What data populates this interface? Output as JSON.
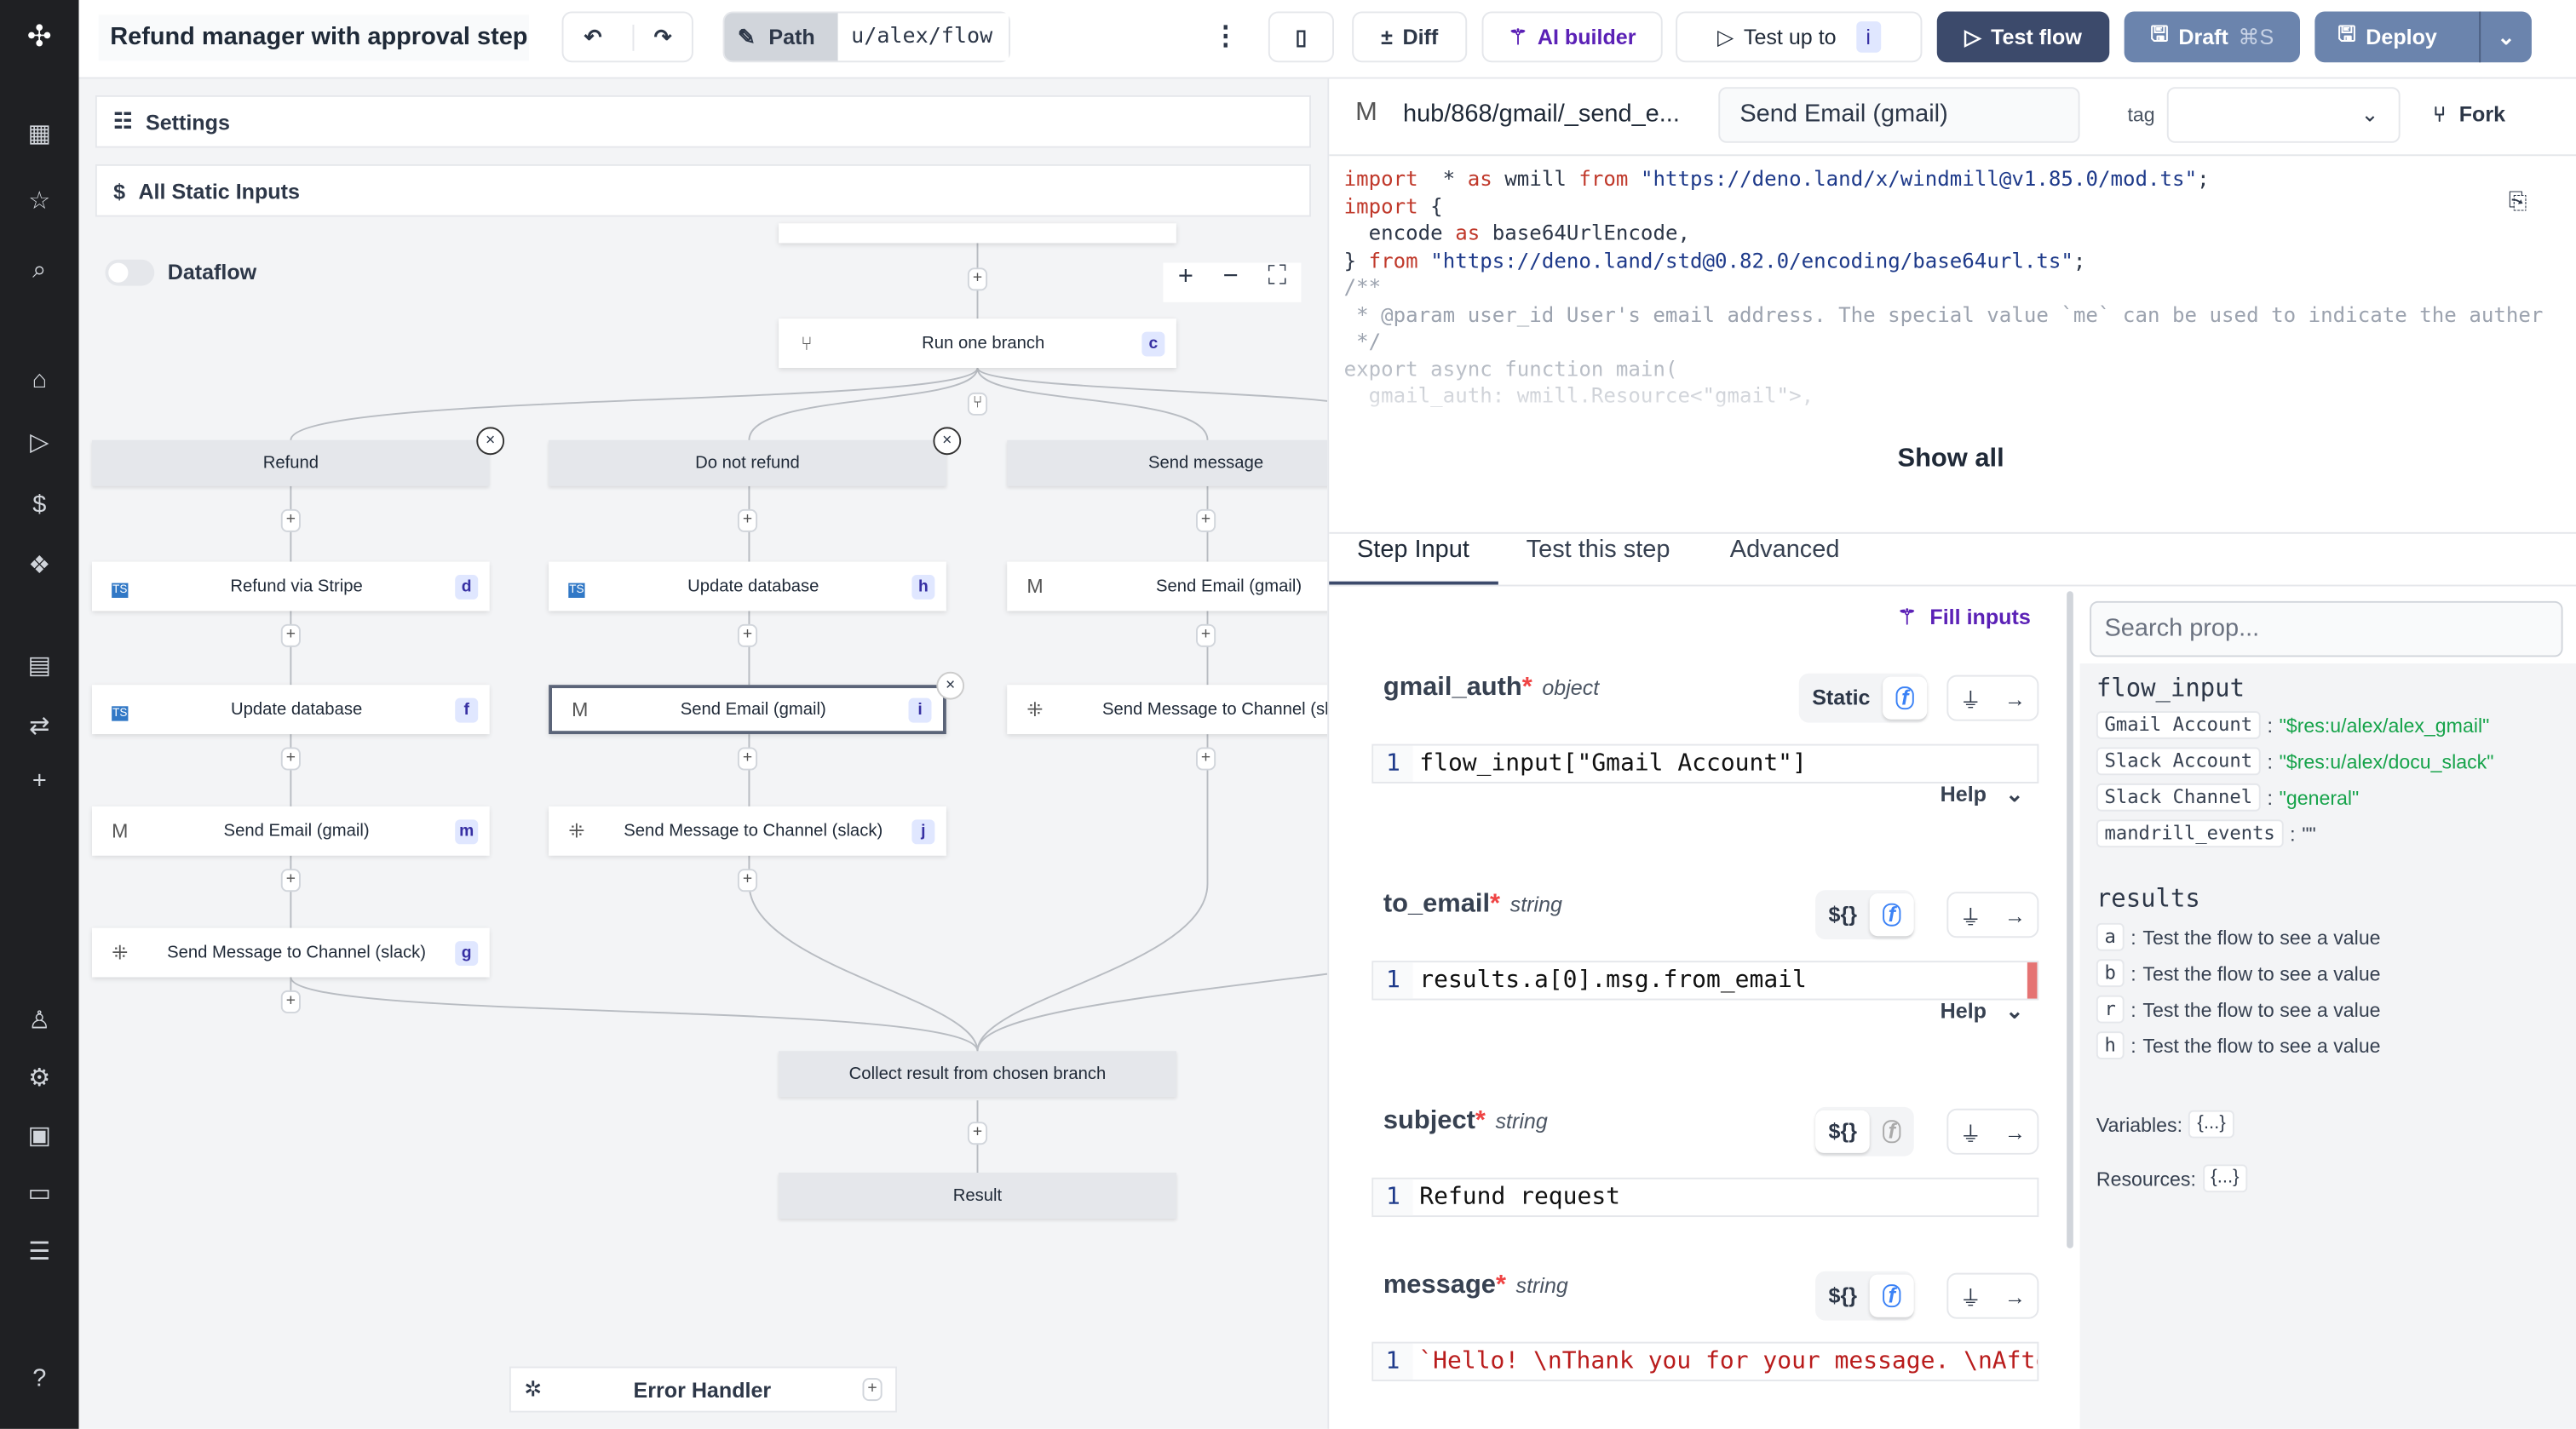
{
  "app": {
    "title": "Refund manager with approval step",
    "path_label": "Path",
    "path_value": "u/alex/flow"
  },
  "toolbar": {
    "diff": "Diff",
    "ai_builder": "AI builder",
    "test_up_to": "Test up to",
    "test_up_to_id": "i",
    "test_flow": "Test flow",
    "draft": "Draft",
    "draft_shortcut": "⌘S",
    "deploy": "Deploy"
  },
  "canvas": {
    "settings": "Settings",
    "static_inputs": "All Static Inputs",
    "dataflow": "Dataflow",
    "dataflow_on": false,
    "run_one_branch": {
      "label": "Run one branch",
      "id": "c"
    },
    "branches": [
      {
        "label": "Refund",
        "nodes": [
          {
            "label": "Refund via Stripe",
            "id": "d",
            "icon": "typescript-icon"
          },
          {
            "label": "Update database",
            "id": "f",
            "icon": "typescript-icon"
          },
          {
            "label": "Send Email (gmail)",
            "id": "m",
            "icon": "gmail-icon"
          },
          {
            "label": "Send Message to Channel (slack)",
            "id": "g",
            "icon": "slack-icon"
          }
        ]
      },
      {
        "label": "Do not refund",
        "nodes": [
          {
            "label": "Update database",
            "id": "h",
            "icon": "typescript-icon"
          },
          {
            "label": "Send Email (gmail)",
            "id": "i",
            "icon": "gmail-icon",
            "selected": true
          },
          {
            "label": "Send Message to Channel (slack)",
            "id": "j",
            "icon": "slack-icon"
          }
        ]
      },
      {
        "label": "Send message",
        "nodes": [
          {
            "label": "Send Email (gmail)",
            "id": "",
            "icon": "gmail-icon"
          },
          {
            "label": "Send Message to Channel (slack",
            "id": "",
            "icon": "slack-icon"
          }
        ]
      }
    ],
    "collect": "Collect result from chosen branch",
    "result": "Result",
    "error_handler": "Error Handler"
  },
  "step": {
    "path": "hub/868/gmail/_send_e...",
    "summary": "Send Email (gmail)",
    "tag_label": "tag",
    "tag_value": "",
    "fork": "Fork",
    "show_all": "Show all",
    "code": [
      [
        [
          "kw",
          "import"
        ],
        [
          "",
          "  * "
        ],
        [
          "kw",
          "as"
        ],
        [
          "",
          " wmill "
        ],
        [
          "kw",
          "from"
        ],
        [
          "str",
          " \"https://deno.land/x/windmill@v1.85.0/mod.ts\""
        ],
        [
          "",
          ";"
        ]
      ],
      [
        [
          "kw",
          "import"
        ],
        [
          "",
          " {"
        ]
      ],
      [
        [
          "",
          "  encode "
        ],
        [
          "kw",
          "as"
        ],
        [
          "",
          " base64UrlEncode,"
        ]
      ],
      [
        [
          "",
          "} "
        ],
        [
          "kw",
          "from"
        ],
        [
          "str",
          " \"https://deno.land/std@0.82.0/encoding/base64url.ts\""
        ],
        [
          "",
          ";"
        ]
      ],
      [
        [
          "",
          ""
        ]
      ],
      [
        [
          "cm",
          "/**"
        ]
      ],
      [
        [
          "cm",
          " * @param user_id User's email address. The special value `me` can be used to indicate the auther"
        ]
      ],
      [
        [
          "cm",
          " */"
        ]
      ],
      [
        [
          "cm",
          "export async function main("
        ]
      ],
      [
        [
          "cm",
          "  gmail_auth: wmill.Resource<\"gmail\">,"
        ]
      ]
    ],
    "tabs": [
      "Step Input",
      "Test this step",
      "Advanced"
    ],
    "active_tab": 0,
    "fill_inputs": "Fill inputs",
    "help": "Help",
    "fields": [
      {
        "name": "gmail_auth",
        "type": "object",
        "mode": "Static",
        "line": "1",
        "value": "flow_input[\"Gmail Account\"]"
      },
      {
        "name": "to_email",
        "type": "string",
        "mode": "${}",
        "line": "1",
        "value": "results.a[0].msg.from_email"
      },
      {
        "name": "subject",
        "type": "string",
        "mode": "${}",
        "line": "1",
        "value": "Refund request"
      },
      {
        "name": "message",
        "type": "string",
        "mode": "${}",
        "line": "1",
        "value": "`Hello! \\nThank you for your message. \\nAfte"
      }
    ]
  },
  "props": {
    "search_placeholder": "Search prop...",
    "flow_input_title": "flow_input",
    "flow_input": [
      {
        "k": "Gmail Account",
        "v": "\"$res:u/alex/alex_gmail\""
      },
      {
        "k": "Slack Account",
        "v": "\"$res:u/alex/docu_slack\""
      },
      {
        "k": "Slack Channel",
        "v": "\"general\""
      },
      {
        "k": "mandrill_events",
        "v": "\"\""
      }
    ],
    "results_title": "results",
    "results": [
      {
        "k": "a",
        "v": "Test the flow to see a value"
      },
      {
        "k": "b",
        "v": "Test the flow to see a value"
      },
      {
        "k": "r",
        "v": "Test the flow to see a value"
      },
      {
        "k": "h",
        "v": "Test the flow to see a value"
      }
    ],
    "variables": "Variables:",
    "resources": "Resources:",
    "collapsed": "{...}"
  },
  "colors": {
    "sidebar": "#1f2023",
    "accent": "#5b21b6",
    "test_flow": "#3c4a6b",
    "draft": "#6b84ad",
    "canvas": "#f3f4f6"
  }
}
